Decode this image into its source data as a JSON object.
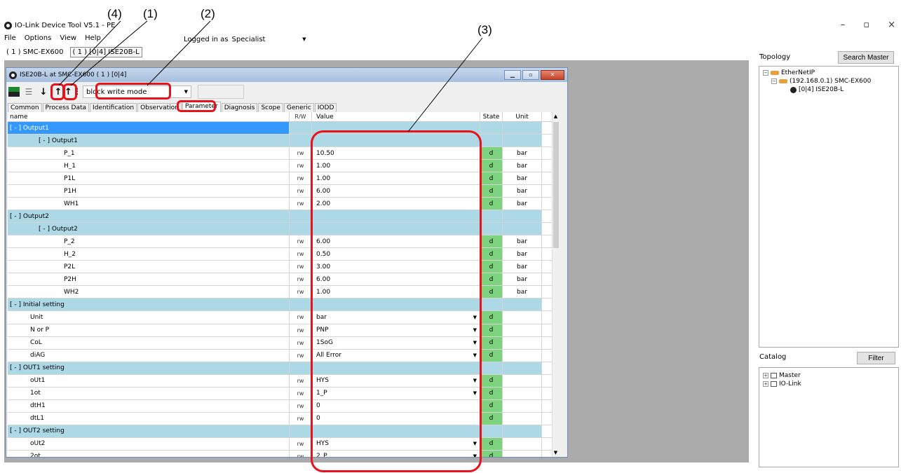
{
  "app": {
    "title": "IO-Link Device Tool V5.1 - PE",
    "win_controls": [
      "–",
      "▫",
      "×"
    ]
  },
  "menu": [
    "File",
    "Options",
    "View",
    "Help"
  ],
  "login": {
    "label": "Logged in as",
    "role": "Specialist"
  },
  "device_tabs": [
    "( 1 ) SMC-EX600",
    "( 1 ) [0|4] ISE20B-L"
  ],
  "inner": {
    "title": "ISE20B-L at SMC-EX600 ( 1 ) [0|4]",
    "mode": "block write mode",
    "tabs": [
      "Common",
      "Process Data",
      "Identification",
      "Observation",
      "Parameter",
      "Diagnosis",
      "Scope",
      "Generic",
      "IODD"
    ],
    "active_tab": "Parameter",
    "columns": {
      "name": "name",
      "rw": "R/W",
      "value": "Value",
      "state": "State",
      "unit": "Unit"
    }
  },
  "rows": [
    {
      "name": "[ - ]  Output1",
      "rw": "",
      "value": "",
      "state": "",
      "unit": "",
      "type": "group",
      "level": 0,
      "sel": true
    },
    {
      "name": "[ - ]  Output1",
      "rw": "",
      "value": "",
      "state": "",
      "unit": "",
      "type": "group",
      "level": 1
    },
    {
      "name": "P_1",
      "rw": "rw",
      "value": "10.50",
      "state": "d",
      "unit": "bar",
      "level": 2
    },
    {
      "name": "H_1",
      "rw": "rw",
      "value": "1.00",
      "state": "d",
      "unit": "bar",
      "level": 2
    },
    {
      "name": "P1L",
      "rw": "rw",
      "value": "1.00",
      "state": "d",
      "unit": "bar",
      "level": 2
    },
    {
      "name": "P1H",
      "rw": "rw",
      "value": "6.00",
      "state": "d",
      "unit": "bar",
      "level": 2
    },
    {
      "name": "WH1",
      "rw": "rw",
      "value": "2.00",
      "state": "d",
      "unit": "bar",
      "level": 2
    },
    {
      "name": "[ - ]  Output2",
      "rw": "",
      "value": "",
      "state": "",
      "unit": "",
      "type": "group",
      "level": 0
    },
    {
      "name": "[ - ]  Output2",
      "rw": "",
      "value": "",
      "state": "",
      "unit": "",
      "type": "group",
      "level": 1
    },
    {
      "name": "P_2",
      "rw": "rw",
      "value": "6.00",
      "state": "d",
      "unit": "bar",
      "level": 2
    },
    {
      "name": "H_2",
      "rw": "rw",
      "value": "0.50",
      "state": "d",
      "unit": "bar",
      "level": 2
    },
    {
      "name": "P2L",
      "rw": "rw",
      "value": "3.00",
      "state": "d",
      "unit": "bar",
      "level": 2
    },
    {
      "name": "P2H",
      "rw": "rw",
      "value": "6.00",
      "state": "d",
      "unit": "bar",
      "level": 2
    },
    {
      "name": "WH2",
      "rw": "rw",
      "value": "1.00",
      "state": "d",
      "unit": "bar",
      "level": 2
    },
    {
      "name": "[ - ]  Initial setting",
      "rw": "",
      "value": "",
      "state": "",
      "unit": "",
      "type": "group",
      "level": 0
    },
    {
      "name": "Unit",
      "rw": "rw",
      "value": "bar",
      "state": "d",
      "unit": "",
      "level": 1,
      "dropdown": true
    },
    {
      "name": "N or P",
      "rw": "rw",
      "value": "PNP",
      "state": "d",
      "unit": "",
      "level": 1,
      "dropdown": true
    },
    {
      "name": "CoL",
      "rw": "rw",
      "value": "1SoG",
      "state": "d",
      "unit": "",
      "level": 1,
      "dropdown": true
    },
    {
      "name": "diAG",
      "rw": "rw",
      "value": "All Error",
      "state": "d",
      "unit": "",
      "level": 1,
      "dropdown": true
    },
    {
      "name": "[ - ]  OUT1 setting",
      "rw": "",
      "value": "",
      "state": "",
      "unit": "",
      "type": "group",
      "level": 0
    },
    {
      "name": "oUt1",
      "rw": "rw",
      "value": "HYS",
      "state": "d",
      "unit": "",
      "level": 1,
      "dropdown": true
    },
    {
      "name": "1ot",
      "rw": "rw",
      "value": "1_P",
      "state": "d",
      "unit": "",
      "level": 1,
      "dropdown": true
    },
    {
      "name": "dtH1",
      "rw": "rw",
      "value": "0",
      "state": "d",
      "unit": "",
      "level": 1
    },
    {
      "name": "dtL1",
      "rw": "rw",
      "value": "0",
      "state": "d",
      "unit": "",
      "level": 1
    },
    {
      "name": "[ - ]  OUT2 setting",
      "rw": "",
      "value": "",
      "state": "",
      "unit": "",
      "type": "group",
      "level": 0
    },
    {
      "name": "oUt2",
      "rw": "rw",
      "value": "HYS",
      "state": "d",
      "unit": "",
      "level": 1,
      "dropdown": true
    },
    {
      "name": "2ot",
      "rw": "rw",
      "value": "2_P",
      "state": "d",
      "unit": "",
      "level": 1,
      "dropdown": true
    }
  ],
  "topology": {
    "label": "Topology",
    "search_button": "Search Master",
    "tree": [
      "EtherNetIP",
      "(192.168.0.1) SMC-EX600",
      "[0|4] ISE20B-L"
    ]
  },
  "catalog": {
    "label": "Catalog",
    "filter_button": "Filter",
    "tree": [
      "Master",
      "IO-Link"
    ]
  },
  "callouts": [
    "(4)",
    "(1)",
    "(2)",
    "(3)"
  ],
  "colors": {
    "group_row": "#add8e6",
    "selected": "#3399ff",
    "state_d": "#7ed37e",
    "annotation": "#e8121b"
  }
}
